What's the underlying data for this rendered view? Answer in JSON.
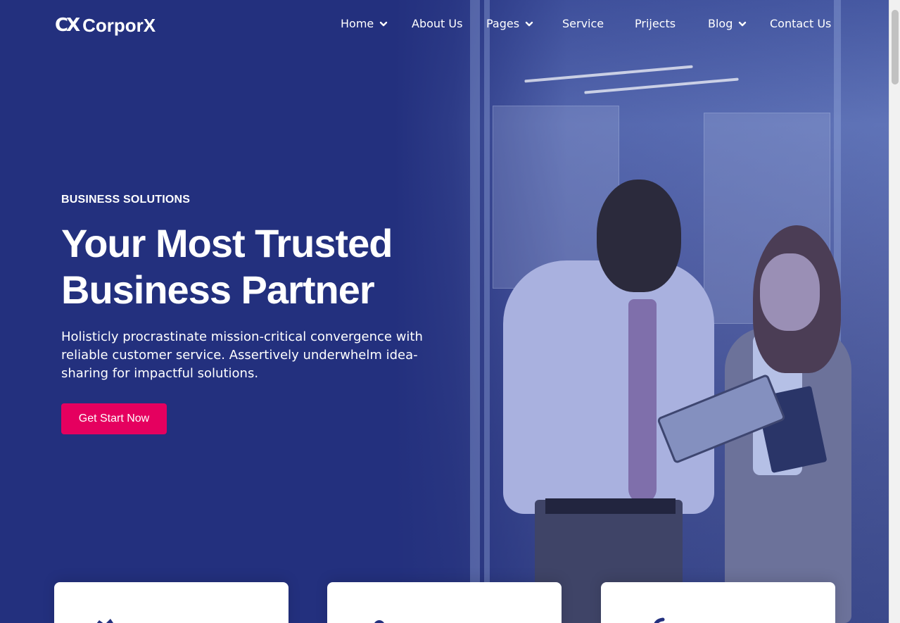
{
  "brand": {
    "logo_mark": "CX",
    "name": "CorporX"
  },
  "nav": {
    "items": [
      {
        "label": "Home",
        "has_dropdown": true
      },
      {
        "label": "About Us",
        "has_dropdown": false
      },
      {
        "label": "Pages",
        "has_dropdown": true
      },
      {
        "label": "Service",
        "has_dropdown": false
      },
      {
        "label": "Prijects",
        "has_dropdown": false
      },
      {
        "label": "Blog",
        "has_dropdown": true
      },
      {
        "label": "Contact Us",
        "has_dropdown": false
      }
    ]
  },
  "hero": {
    "eyebrow": "BUSINESS SOLUTIONS",
    "headline_line1": "Your Most Trusted",
    "headline_line2": "Business Partner",
    "lead": "Holisticly procrastinate mission-critical convergence with reliable customer service. Assertively underwhelm idea-sharing for impactful solutions.",
    "cta_label": "Get Start Now"
  },
  "colors": {
    "hero_bg": "#23307e",
    "accent": "#e5005f",
    "text_light": "#ffffff",
    "icon_dark": "#23307e"
  },
  "feature_cards": [
    {
      "icon": "feature-icon-1"
    },
    {
      "icon": "feature-icon-2"
    },
    {
      "icon": "feature-icon-3"
    }
  ]
}
